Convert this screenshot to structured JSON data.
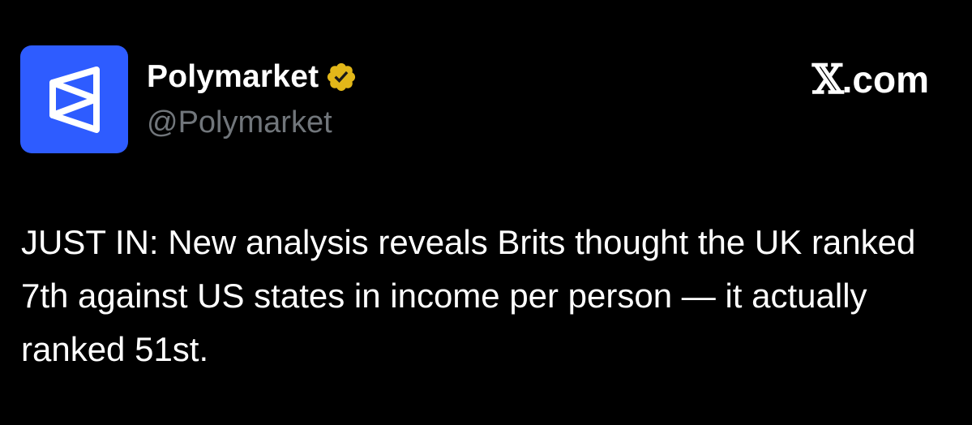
{
  "header": {
    "display_name": "Polymarket",
    "handle": "@Polymarket",
    "verified_badge_color": "#e2b719",
    "avatar_color": "#2e5cff",
    "site_label": "𝕏.com",
    "site_label_x": "𝕏",
    "site_label_suffix": ".com"
  },
  "tweet": {
    "text": "JUST IN: New analysis reveals Brits thought the UK ranked 7th against US states in income per person — it actually ranked 51st."
  },
  "icons": {
    "avatar": "polymarket-logo-icon",
    "badge": "verified-badge-icon"
  }
}
